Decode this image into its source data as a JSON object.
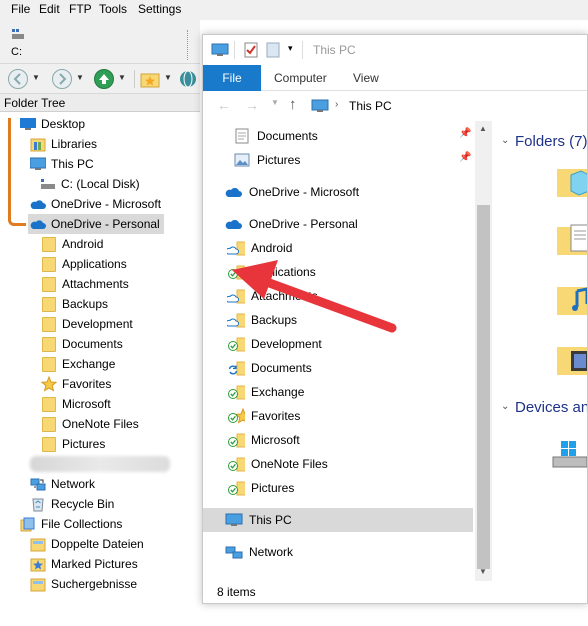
{
  "menubar": {
    "items": [
      "File",
      "Edit",
      "FTP",
      "Tools",
      "Settings"
    ]
  },
  "drive_path": "C:",
  "tree": {
    "header": "Folder Tree",
    "items": [
      {
        "label": "Desktop",
        "icon": "desktop-icon"
      },
      {
        "label": "Libraries",
        "icon": "libraries-icon"
      },
      {
        "label": "This PC",
        "icon": "this-pc-icon"
      },
      {
        "label": "C: (Local Disk)",
        "icon": "disk-icon"
      },
      {
        "label": "OneDrive - Microsoft",
        "icon": "cloud-icon"
      },
      {
        "label": "OneDrive - Personal",
        "icon": "cloud-icon"
      },
      {
        "label": "Android",
        "icon": "folder-icon"
      },
      {
        "label": "Applications",
        "icon": "folder-icon"
      },
      {
        "label": "Attachments",
        "icon": "folder-icon"
      },
      {
        "label": "Backups",
        "icon": "folder-icon"
      },
      {
        "label": "Development",
        "icon": "folder-icon"
      },
      {
        "label": "Documents",
        "icon": "folder-icon"
      },
      {
        "label": "Exchange",
        "icon": "folder-icon"
      },
      {
        "label": "Favorites",
        "icon": "star-icon"
      },
      {
        "label": "Microsoft",
        "icon": "folder-icon"
      },
      {
        "label": "OneNote Files",
        "icon": "folder-icon"
      },
      {
        "label": "Pictures",
        "icon": "folder-icon"
      },
      {
        "label": "Network",
        "icon": "network-icon"
      },
      {
        "label": "Recycle Bin",
        "icon": "recycle-bin-icon"
      },
      {
        "label": "File Collections",
        "icon": "collections-icon"
      },
      {
        "label": "Doppelte Dateien",
        "icon": "collection-folder-icon"
      },
      {
        "label": "Marked Pictures",
        "icon": "collection-star-icon"
      },
      {
        "label": "Suchergebnisse",
        "icon": "collection-folder-icon"
      }
    ]
  },
  "explorer": {
    "title": "This PC",
    "tabs": [
      "File",
      "Computer",
      "View"
    ],
    "address": "This PC",
    "nav_items": [
      {
        "label": "Documents",
        "icon": "documents-icon",
        "pinned": true
      },
      {
        "label": "Pictures",
        "icon": "pictures-icon",
        "pinned": true
      },
      {
        "label": "OneDrive - Microsoft",
        "icon": "cloud-icon"
      },
      {
        "label": "OneDrive - Personal",
        "icon": "cloud-icon"
      },
      {
        "label": "Android",
        "icon": "folder-icon",
        "status": "cloud"
      },
      {
        "label": "Applications",
        "icon": "folder-icon",
        "status": "synced"
      },
      {
        "label": "Attachments",
        "icon": "folder-icon",
        "status": "cloud"
      },
      {
        "label": "Backups",
        "icon": "folder-icon",
        "status": "cloud"
      },
      {
        "label": "Development",
        "icon": "folder-icon",
        "status": "synced"
      },
      {
        "label": "Documents",
        "icon": "folder-icon",
        "status": "syncing"
      },
      {
        "label": "Exchange",
        "icon": "folder-icon",
        "status": "synced"
      },
      {
        "label": "Favorites",
        "icon": "star-icon",
        "status": "synced"
      },
      {
        "label": "Microsoft",
        "icon": "folder-icon",
        "status": "synced"
      },
      {
        "label": "OneNote Files",
        "icon": "folder-icon",
        "status": "synced"
      },
      {
        "label": "Pictures",
        "icon": "folder-icon",
        "status": "synced"
      },
      {
        "label": "This PC",
        "icon": "this-pc-icon"
      },
      {
        "label": "Network",
        "icon": "network-icon"
      }
    ],
    "sections": {
      "folders": "Folders (7)",
      "devices": "Devices and"
    },
    "status": "8 items"
  },
  "colors": {
    "ribbon_file_tab": "#1979ca",
    "annotation_arrow": "#e8353b",
    "annotation_line": "#e07b22",
    "onedrive_blue": "#1a73c9",
    "synced_green": "#2e9e3b",
    "folder_yellow": "#f8d775"
  }
}
